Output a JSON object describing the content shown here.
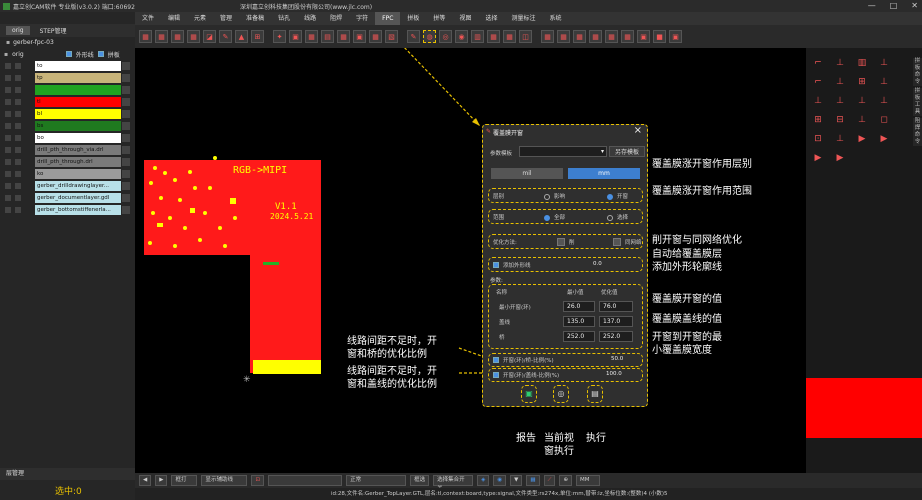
{
  "app": {
    "title": "嘉立创CAM软件 专业版(v3.0.2) 端口:60692",
    "center_title": "深圳嘉立创科技集团股份有限公司(www.jlc.com)",
    "win_min": "—",
    "win_max": "□",
    "win_close": "✕"
  },
  "menu": {
    "items": [
      "文件",
      "编辑",
      "元素",
      "管理",
      "准备稿",
      "钻孔",
      "线路",
      "阻焊",
      "字符",
      "FPC",
      "拼板",
      "拼等",
      "视图",
      "选择",
      "测量标注",
      "系统"
    ],
    "active_index": 9
  },
  "left_panel": {
    "tabs": [
      "orig",
      "STEP管理"
    ],
    "project": "gerber-fpc-03",
    "orig_label": "orig",
    "outline_label": "外形线",
    "panel_label": "拼板",
    "layers": [
      {
        "name": "to",
        "color": "#ffffff"
      },
      {
        "name": "tp",
        "color": "#c8b47a"
      },
      {
        "name": "",
        "color": "#21a321"
      },
      {
        "name": "tl",
        "color": "#ff0000"
      },
      {
        "name": "bl",
        "color": "#ffff00"
      },
      {
        "name": "bs",
        "color": "#1f7a1f"
      },
      {
        "name": "bo",
        "color": "#ffffff"
      },
      {
        "name": "drill_pth_through_via.drl",
        "color": "#7a7a7a"
      },
      {
        "name": "drill_pth_through.drl",
        "color": "#7a7a7a"
      },
      {
        "name": "ko",
        "color": "#9b9b9b"
      },
      {
        "name": "gerber_drilldrawinglayer...",
        "color": "#b8e0e8"
      },
      {
        "name": "gerber_documentlayer.gdl",
        "color": "#b8e0e8"
      },
      {
        "name": "gerber_bottomstiffenerla...",
        "color": "#b8e0e8"
      }
    ],
    "bottom_tab": "层管理",
    "selected": "选中:0"
  },
  "dialog": {
    "title": "覆盖膜开窗",
    "template_label": "参数模板",
    "save_template": "另存模板",
    "unit_mil": "mil",
    "unit_mm": "mm",
    "layer_label": "层别",
    "layer_opt1": "影响",
    "layer_opt2": "开窗",
    "scope_label": "范围",
    "scope_opt1": "全部",
    "scope_opt2": "选择",
    "optimize_label": "优化方法:",
    "opt_a": "削",
    "opt_b": "同网络",
    "add_outline": "添加外形线",
    "add_outline_value": "0.0",
    "params_label": "参数:",
    "col_name": "名称",
    "col_min": "最小值",
    "col_opt": "优化值",
    "rows": [
      {
        "name": "最小开窗(环)",
        "min": "26.0",
        "opt": "76.0"
      },
      {
        "name": "盖线",
        "min": "135.0",
        "opt": "137.0"
      },
      {
        "name": "桥",
        "min": "252.0",
        "opt": "252.0"
      }
    ],
    "ratio1_label": "开窗(环)/桥-比例(%)",
    "ratio1_value": "50.0",
    "ratio2_label": "开窗(环)/盖线-比例(%)",
    "ratio2_value": "100.0"
  },
  "annotations": {
    "a1": "覆盖膜涨开窗作用层别",
    "a2": "覆盖膜涨开窗作用范围",
    "a3": "削开窗与同网络优化",
    "a4": "自动给覆盖膜层\n添加外形轮廓线",
    "a5": "覆盖膜开窗的值",
    "a6": "覆盖膜盖线的值",
    "a7": "开窗到开窗的最\n小覆盖膜宽度",
    "a8": "线路间距不足时，开\n窗和桥的优化比例",
    "a9": "线路间距不足时，开\n窗和盖线的优化比例",
    "a10": "报告",
    "a11": "当前视\n窗执行",
    "a12": "执行"
  },
  "pcb": {
    "text1": "RGB->MIPI",
    "text2": "V1.1",
    "text3": "2024.5.21"
  },
  "bottom": {
    "combo1": "框打",
    "btn_show": "显示辅助线",
    "combo2": "正常",
    "btn_select": "框选",
    "btn_filter": "选择集合开关",
    "unit": "MM"
  },
  "right_panel": {
    "labels": [
      "拼板命令",
      "拼板工具",
      "阻焊命令"
    ]
  },
  "status": "id:28,文件名:Gerber_TopLayer.GTL,层名:tl,context:board,type:signal,文件类型:rs274x,单位:mm,替带:lz,坐标位数:(整数)4 (小数)5",
  "colors": {
    "accent": "#e8c000",
    "pcb_red": "#ff0000",
    "highlight_blue": "#4a90e2"
  }
}
